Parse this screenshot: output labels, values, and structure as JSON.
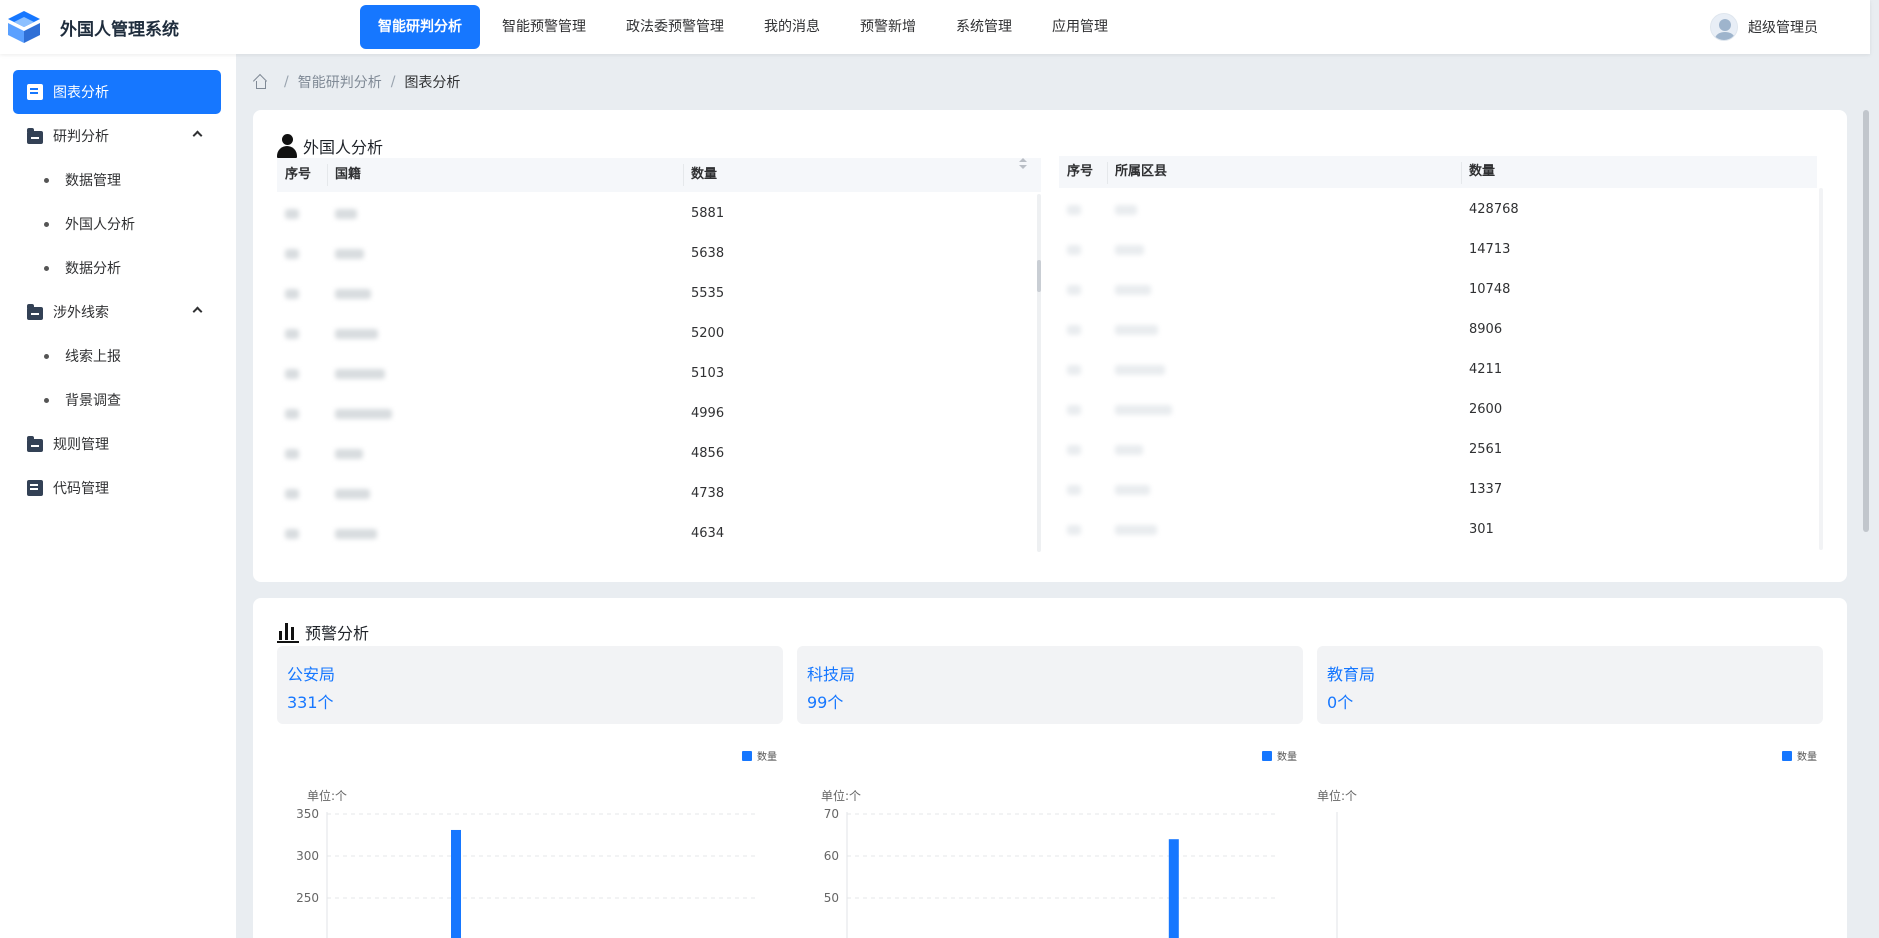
{
  "app": {
    "title": "外国人管理系统"
  },
  "nav": [
    {
      "label": "智能研判分析",
      "active": true
    },
    {
      "label": "智能预警管理"
    },
    {
      "label": "政法委预警管理"
    },
    {
      "label": "我的消息"
    },
    {
      "label": "预警新增"
    },
    {
      "label": "系统管理"
    },
    {
      "label": "应用管理"
    }
  ],
  "user": {
    "name": "超级管理员"
  },
  "sidebar": {
    "items": [
      {
        "label": "图表分析",
        "icon": "doc-chart-icon",
        "active": true
      },
      {
        "label": "研判分析",
        "icon": "folder-icon",
        "expanded": true
      },
      {
        "label": "数据管理",
        "sub": true
      },
      {
        "label": "外国人分析",
        "sub": true
      },
      {
        "label": "数据分析",
        "sub": true
      },
      {
        "label": "涉外线索",
        "icon": "folder-icon",
        "expanded": true
      },
      {
        "label": "线索上报",
        "sub": true
      },
      {
        "label": "背景调查",
        "sub": true
      },
      {
        "label": "规则管理",
        "icon": "folder-icon"
      },
      {
        "label": "代码管理",
        "icon": "doc-chart-icon"
      }
    ]
  },
  "breadcrumb": {
    "items": [
      "智能研判分析",
      "图表分析"
    ]
  },
  "foreigner_analysis": {
    "title": "外国人分析",
    "nationality_table": {
      "headers": [
        "序号",
        "国籍",
        "数量"
      ],
      "rows": [
        {
          "count": "5881"
        },
        {
          "count": "5638"
        },
        {
          "count": "5535"
        },
        {
          "count": "5200"
        },
        {
          "count": "5103"
        },
        {
          "count": "4996"
        },
        {
          "count": "4856"
        },
        {
          "count": "4738"
        },
        {
          "count": "4634"
        }
      ]
    },
    "district_table": {
      "headers": [
        "序号",
        "所属区县",
        "数量"
      ],
      "rows": [
        {
          "count": "428768"
        },
        {
          "count": "14713"
        },
        {
          "count": "10748"
        },
        {
          "count": "8906"
        },
        {
          "count": "4211"
        },
        {
          "count": "2600"
        },
        {
          "count": "2561"
        },
        {
          "count": "1337"
        },
        {
          "count": "301"
        }
      ]
    }
  },
  "warning_analysis": {
    "title": "预警分析",
    "bureaus": [
      {
        "name": "公安局",
        "count": "331",
        "unit": "个"
      },
      {
        "name": "科技局",
        "count": "99",
        "unit": "个"
      },
      {
        "name": "教育局",
        "count": "0",
        "unit": "个"
      }
    ]
  },
  "chart_data": [
    {
      "type": "bar",
      "legend": [
        "数量"
      ],
      "unit_label": "单位:个",
      "ylim": [
        200,
        350
      ],
      "ticks": [
        350,
        300,
        250
      ],
      "series": [
        {
          "name": "数量",
          "values": [
            331
          ]
        }
      ],
      "bar_position_fraction": 0.3,
      "color": "#1677ff"
    },
    {
      "type": "bar",
      "legend": [
        "数量"
      ],
      "unit_label": "单位:个",
      "ylim": [
        40,
        70
      ],
      "ticks": [
        70,
        60,
        50
      ],
      "series": [
        {
          "name": "数量",
          "values": [
            64
          ]
        }
      ],
      "bar_position_fraction": 0.76,
      "color": "#1677ff"
    },
    {
      "type": "bar",
      "legend": [
        "数量"
      ],
      "unit_label": "单位:个",
      "ticks": [],
      "series": [
        {
          "name": "数量",
          "values": []
        }
      ],
      "color": "#1677ff"
    }
  ],
  "colors": {
    "accent": "#1677ff",
    "background": "#e9edf1"
  }
}
